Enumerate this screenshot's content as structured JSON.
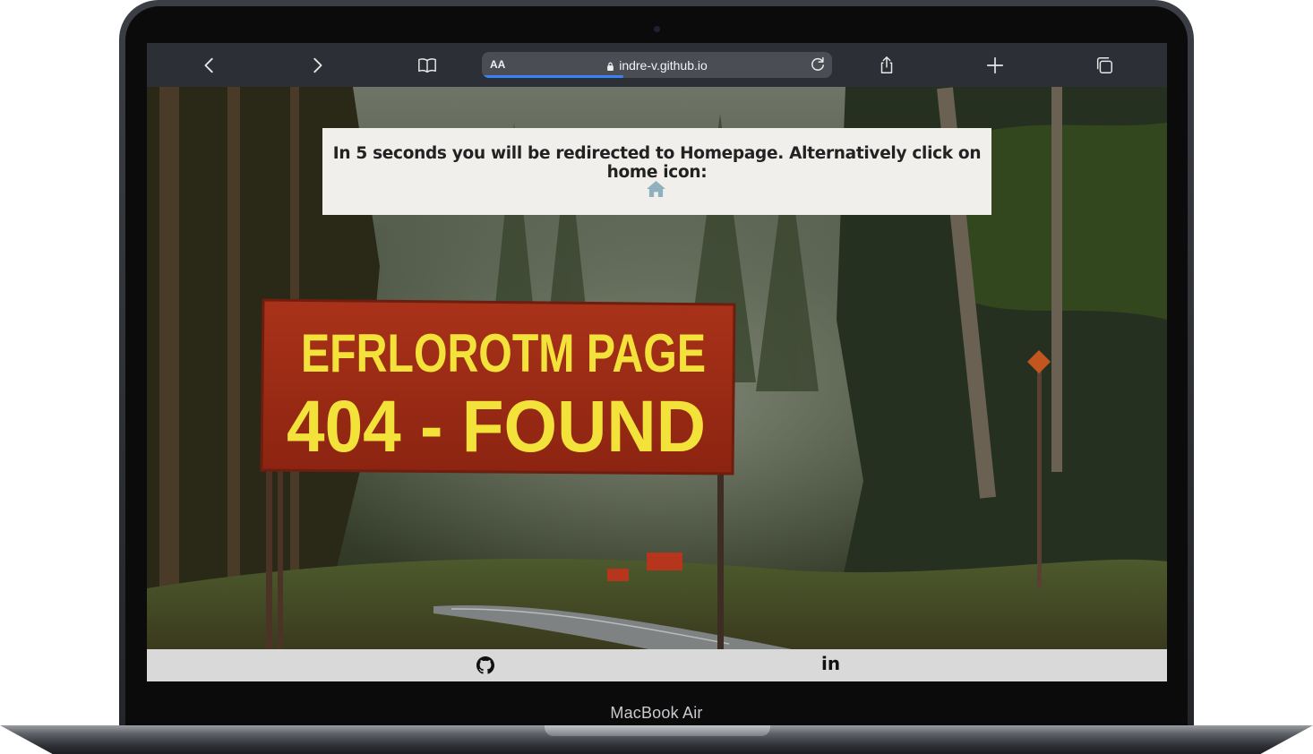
{
  "device": {
    "label": "MacBook Air"
  },
  "browser": {
    "reader_label": "AA",
    "url": "indre-v.github.io",
    "load_progress": 0.4,
    "icons": [
      "chevron-left-icon",
      "chevron-right-icon",
      "bookmarks-icon",
      "lock-icon",
      "reload-icon",
      "share-icon",
      "new-tab-icon",
      "tabs-icon"
    ]
  },
  "page": {
    "notice_text": "In 5 seconds you will be redirected to Homepage. Alternatively click on home icon:",
    "home_icon": "home-icon",
    "background_sign": {
      "line1": "EFRLOROTM PAGE",
      "line2": "404 - FOUND"
    },
    "footer_icons": [
      "github-icon",
      "linkedin-icon"
    ],
    "linkedin_text": "in",
    "colors": {
      "notice_bg": "#f1efec",
      "home_icon": "#8fb0bd",
      "footer_bg": "#d9d9d9",
      "sign_red": "#9c2a15",
      "sign_yellow": "#f3e23a"
    }
  }
}
